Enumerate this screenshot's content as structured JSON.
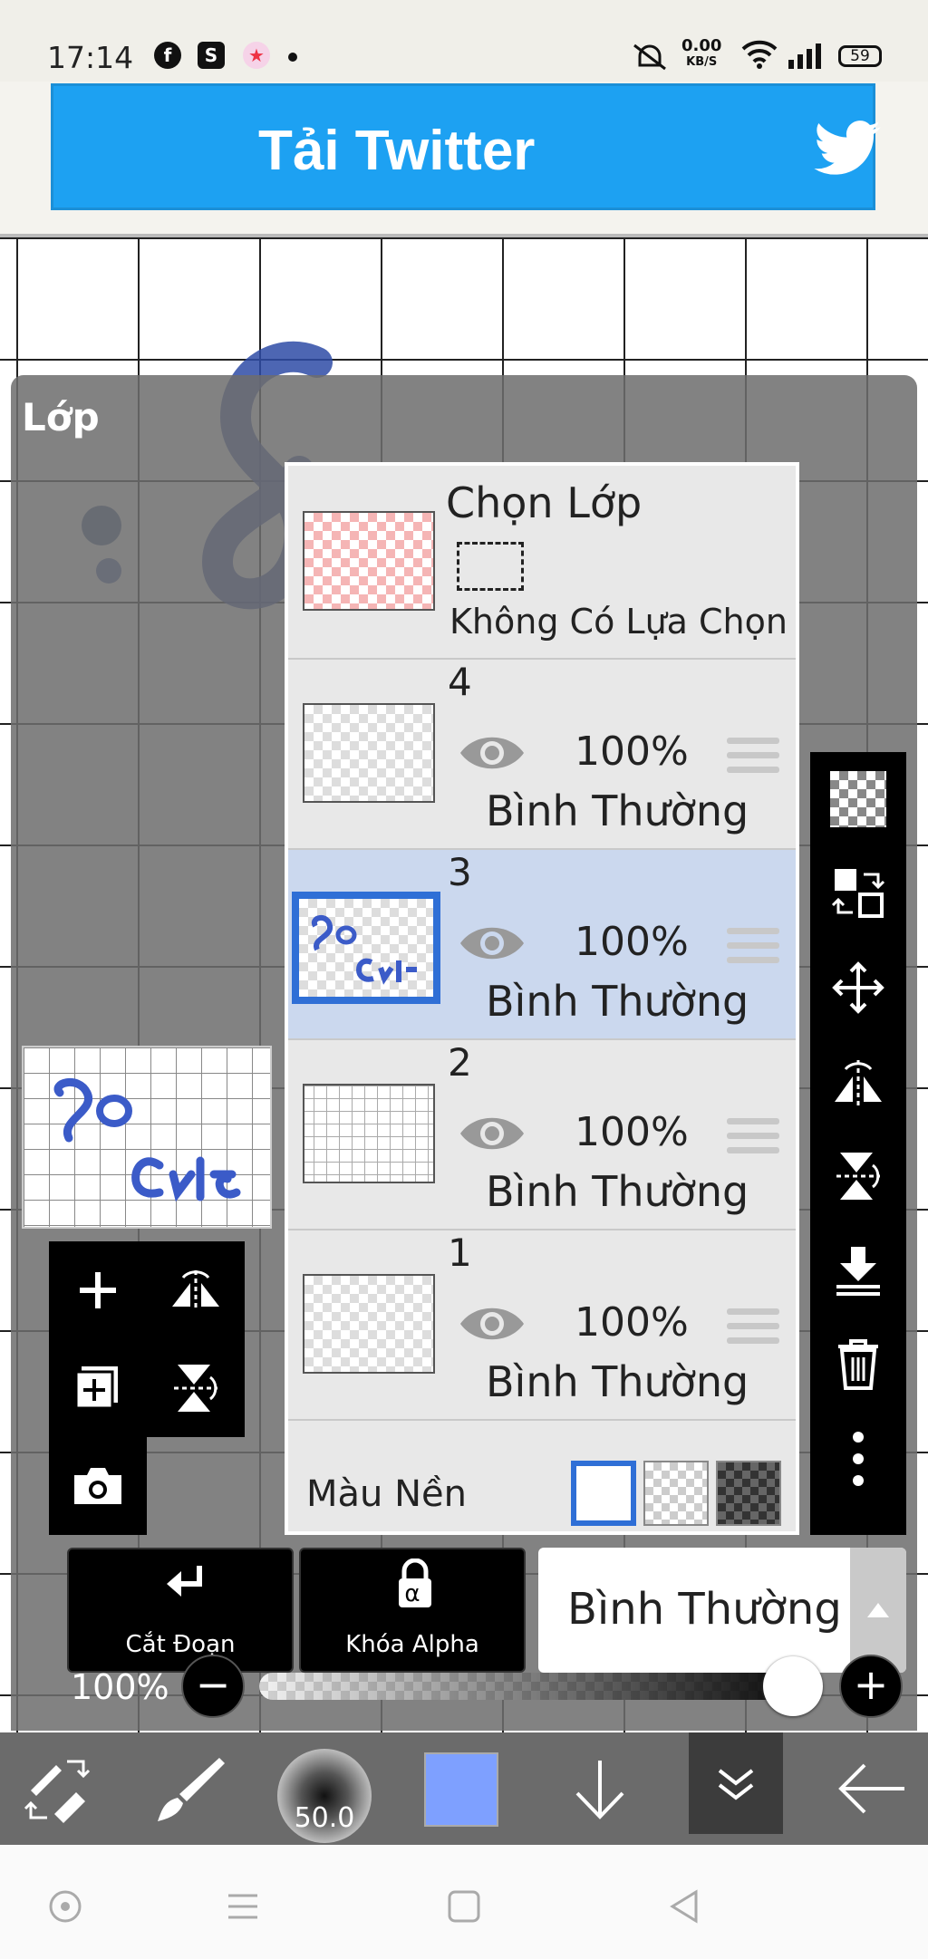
{
  "status_bar": {
    "time": "17:14",
    "net_speed": "0.00",
    "net_unit": "KB/S",
    "battery": "59"
  },
  "ad": {
    "text": "Tải Twitter"
  },
  "panel": {
    "title": "Lớp"
  },
  "selection_layer": {
    "title": "Chọn Lớp",
    "subtitle": "Không Có Lựa Chọn"
  },
  "layers": [
    {
      "number": "4",
      "opacity": "100%",
      "blend": "Bình Thường",
      "selected": false
    },
    {
      "number": "3",
      "opacity": "100%",
      "blend": "Bình Thường",
      "selected": true
    },
    {
      "number": "2",
      "opacity": "100%",
      "blend": "Bình Thường",
      "selected": false
    },
    {
      "number": "1",
      "opacity": "100%",
      "blend": "Bình Thường",
      "selected": false
    }
  ],
  "background_color": {
    "label": "Màu Nền"
  },
  "actions": {
    "clip_label": "Cắt Đoạn",
    "alpha_lock_label": "Khóa Alpha",
    "alpha_symbol": "α",
    "blend_mode": "Bình Thường"
  },
  "opacity_slider": {
    "label": "100%",
    "value": 1.0,
    "minus": "−",
    "plus": "+"
  },
  "toolbar": {
    "brush_size": "50.0",
    "color": "#7ea0ff"
  },
  "colors": {
    "twitter_blue": "#1da1f2",
    "selection_blue": "#2f6fd6",
    "selected_row": "#cbd8ee"
  }
}
